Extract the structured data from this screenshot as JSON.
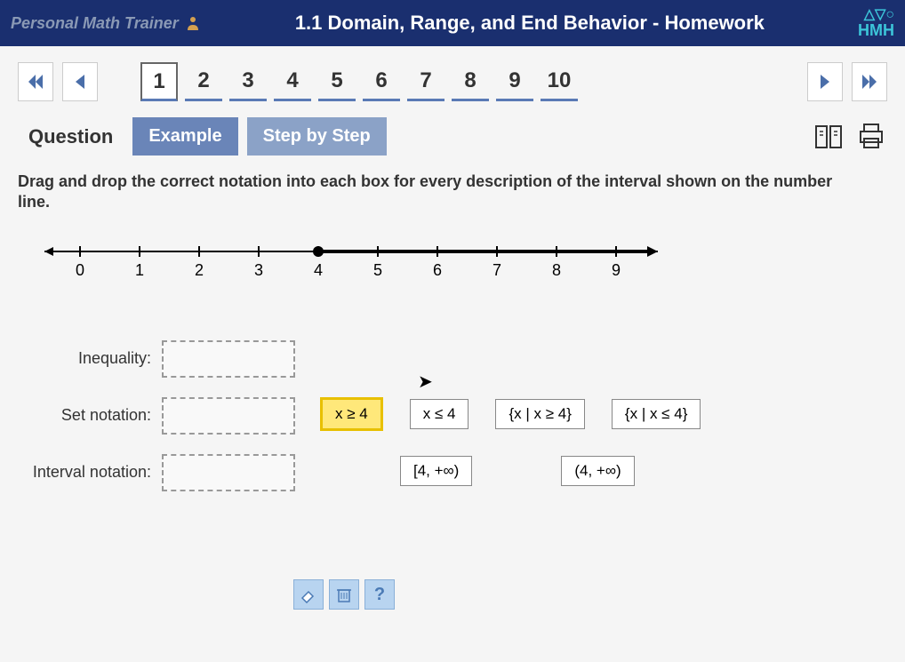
{
  "header": {
    "brand": "Personal Math Trainer",
    "title": "1.1 Domain, Range, and End Behavior - Homework",
    "logo_top": "△▽○",
    "logo_bottom": "HMH"
  },
  "nav": {
    "pages": [
      "1",
      "2",
      "3",
      "4",
      "5",
      "6",
      "7",
      "8",
      "9",
      "10"
    ],
    "active": 0
  },
  "tabs": {
    "question": "Question",
    "example": "Example",
    "step": "Step by Step"
  },
  "instruction": "Drag and drop the correct notation into each box for every description of the interval shown on the number line.",
  "number_line": {
    "min": 0,
    "max": 9,
    "closed_point": 4,
    "labels": [
      "0",
      "1",
      "2",
      "3",
      "4",
      "5",
      "6",
      "7",
      "8",
      "9"
    ]
  },
  "answers": {
    "inequality_label": "Inequality:",
    "set_label": "Set notation:",
    "interval_label": "Interval notation:"
  },
  "drag": {
    "row1": [
      "x ≥ 4",
      "x ≤ 4",
      "{x | x ≥ 4}",
      "{x | x ≤ 4}"
    ],
    "row2": [
      "[4, +∞)",
      "(4, +∞)"
    ]
  },
  "tools": {
    "eraser": "eraser",
    "trash": "trash",
    "help": "?"
  }
}
